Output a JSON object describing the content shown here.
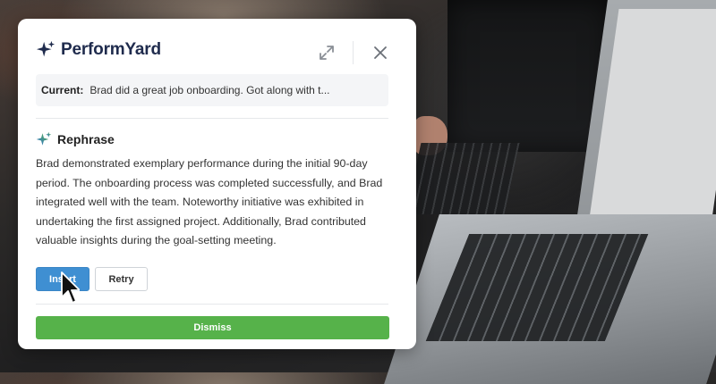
{
  "brand": {
    "name": "PerformYard",
    "icon": "sparkle-logo-icon",
    "color": "#1f2b4d"
  },
  "header": {
    "expand_icon": "expand-icon",
    "close_icon": "close-icon"
  },
  "current": {
    "label": "Current:",
    "value": "Brad did a great job onboarding. Got along with t..."
  },
  "rephrase": {
    "icon": "sparkle-icon",
    "title": "Rephrase",
    "text": "Brad demonstrated exemplary performance during the initial 90-day period. The onboarding process was completed successfully, and Brad integrated well with the team. Noteworthy initiative was exhibited in undertaking the first assigned project. Additionally, Brad contributed valuable insights during the goal-setting meeting."
  },
  "actions": {
    "insert_label": "Insert",
    "retry_label": "Retry",
    "dismiss_label": "Dismiss"
  },
  "colors": {
    "insert_button": "#3f8fd2",
    "dismiss_button": "#56b24a",
    "sparkle_gradient": [
      "#2f6fd6",
      "#56b24a"
    ]
  }
}
